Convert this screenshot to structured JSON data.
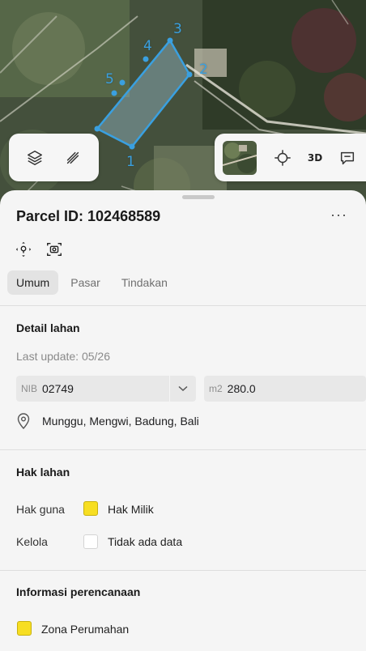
{
  "map": {
    "parcel_vertex_labels": [
      "1",
      "2",
      "3",
      "4",
      "5"
    ],
    "toolbar_left": [
      "layers-icon",
      "measure-icon"
    ],
    "toolbar_right": {
      "thumbnail": "satellite-thumbnail",
      "locate_icon": "crosshair-icon",
      "label_3d": "3D",
      "more_icon": "comment-icon"
    },
    "parcel_color": "#3aa0e0"
  },
  "sheet": {
    "title": "Parcel ID: 102468589",
    "more_label": "···",
    "actions": [
      "focus-icon",
      "camera-icon"
    ],
    "tabs": [
      {
        "label": "Umum",
        "active": true
      },
      {
        "label": "Pasar",
        "active": false
      },
      {
        "label": "Tindakan",
        "active": false
      }
    ],
    "detail": {
      "heading": "Detail lahan",
      "last_update": "Last update: 05/26",
      "nib_prefix": "NIB",
      "nib_value": "02749",
      "area_prefix": "m2",
      "area_value": "280.0",
      "location": "Munggu, Mengwi, Badung, Bali"
    },
    "rights": {
      "heading": "Hak lahan",
      "rows": [
        {
          "label": "Hak guna",
          "value": "Hak Milik",
          "swatch": "#f7de22"
        },
        {
          "label": "Kelola",
          "value": "Tidak ada data",
          "swatch": "#ffffff"
        }
      ]
    },
    "planning": {
      "heading": "Informasi perencanaan",
      "zone": "Zona Perumahan",
      "zone_color": "#f7de22"
    }
  }
}
